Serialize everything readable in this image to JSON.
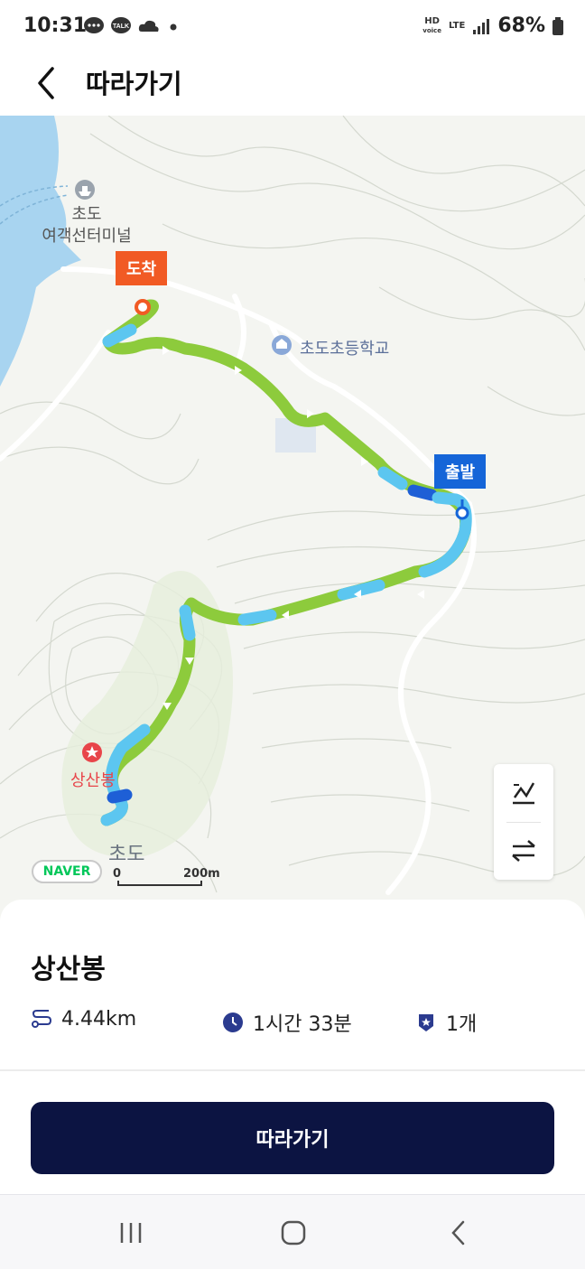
{
  "status_bar": {
    "time": "10:31",
    "network": "LTE",
    "hd_voice": "HD voice",
    "battery": "68%",
    "notification_icons": [
      "chat-bubble-icon",
      "talk-icon",
      "cloud-icon",
      "dot-icon"
    ]
  },
  "app_bar": {
    "title": "따라가기",
    "back_icon": "chevron-left-icon"
  },
  "map": {
    "labels": {
      "ferry_terminal": "초도\n여객선터미널",
      "school": "초도초등학교",
      "peak": "상산봉",
      "island": "초도"
    },
    "markers": {
      "end_label": "도착",
      "start_label": "출발"
    },
    "scale": {
      "zero": "0",
      "distance": "200m"
    },
    "logo": "NAVER",
    "tools": [
      "elevation-icon",
      "swap-direction-icon"
    ],
    "colors": {
      "water": "#a8d4f0",
      "route_green": "#8dcb3c",
      "route_blue": "#5cc6f0",
      "route_dark_blue": "#1e5fd6",
      "end_marker": "#f15a24",
      "start_marker": "#1565d8"
    }
  },
  "course": {
    "name": "상산봉",
    "distance": "4.44km",
    "duration": "1시간 33분",
    "peaks_count": "1개"
  },
  "actions": {
    "follow_button": "따라가기"
  },
  "system_nav": {
    "buttons": [
      "recent-apps-icon",
      "home-icon",
      "back-icon"
    ]
  }
}
